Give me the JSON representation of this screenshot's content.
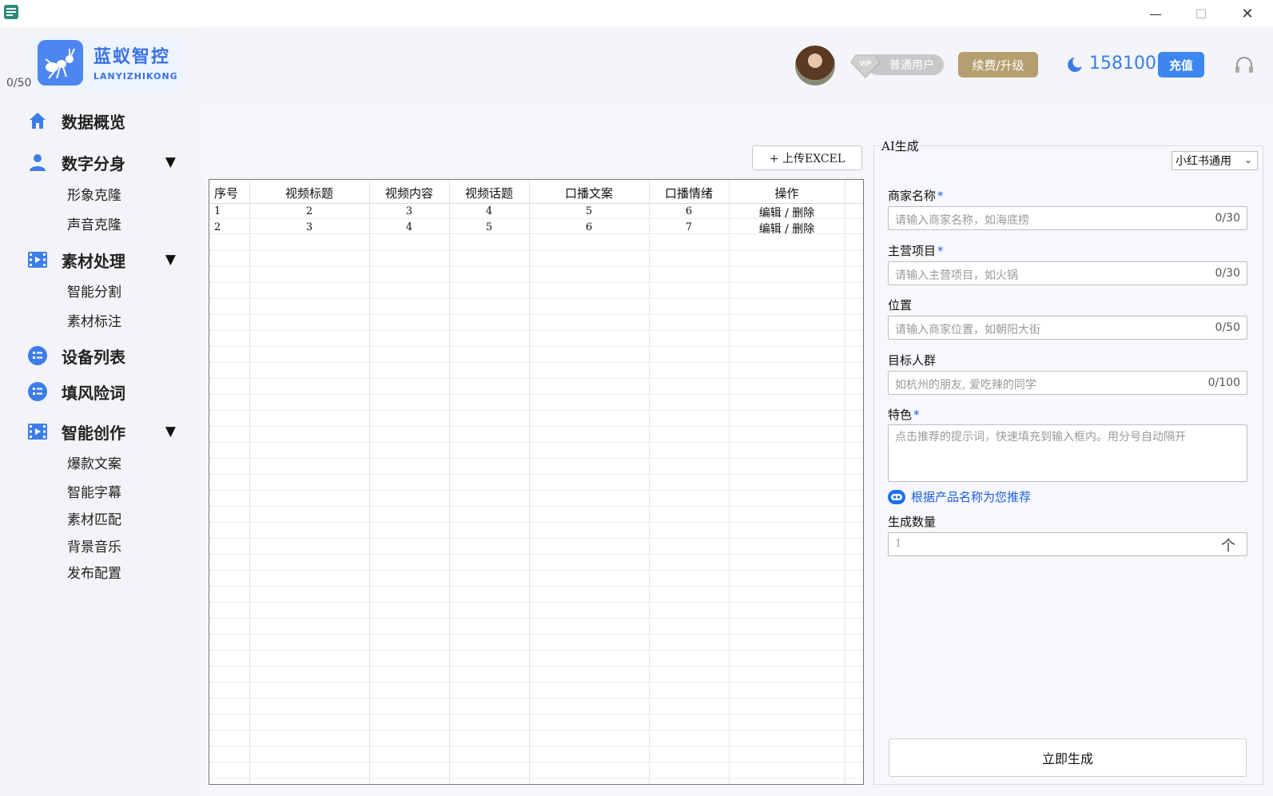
{
  "window": {
    "minimize_glyph": "—",
    "maximize_glyph": "☐",
    "close_glyph": "✕"
  },
  "sidebar": {
    "logo_cn": "蓝蚁智控",
    "logo_en": "LANYIZHIKONG",
    "counter": "0/50",
    "nav": [
      {
        "label": "数据概览",
        "icon": "home-icon"
      },
      {
        "label": "数字分身",
        "icon": "user-icon",
        "caret": "▼",
        "children": [
          "形象克隆",
          "声音克隆"
        ]
      },
      {
        "label": "素材处理",
        "icon": "film-icon",
        "caret": "▼",
        "children": [
          "智能分割",
          "素材标注"
        ]
      },
      {
        "label": "设备列表",
        "icon": "list-icon"
      },
      {
        "label": "填风险词",
        "icon": "list-icon"
      },
      {
        "label": "智能创作",
        "icon": "film-icon",
        "caret": "▼",
        "children": [
          "爆款文案",
          "智能字幕",
          "素材匹配",
          "背景音乐",
          "发布配置"
        ]
      }
    ]
  },
  "header": {
    "vip_label": "普通用户",
    "vip_mark": "VIP",
    "renew_label": "续费/升级",
    "balance": "158100",
    "recharge_label": "充值"
  },
  "toolbar": {
    "upload_label": "+ 上传EXCEL"
  },
  "table": {
    "columns": [
      "序号",
      "视频标题",
      "视频内容",
      "视频话题",
      "口播文案",
      "口播情绪",
      "操作"
    ],
    "rows": [
      [
        "1",
        "2",
        "3",
        "4",
        "5",
        "6",
        "编辑 / 删除"
      ],
      [
        "2",
        "3",
        "4",
        "5",
        "6",
        "7",
        "编辑 / 删除"
      ]
    ]
  },
  "ai_panel": {
    "title": "AI生成",
    "template": "小红书通用",
    "fields": [
      {
        "label": "商家名称",
        "required": "*",
        "placeholder": "请输入商家名称，如海底捞",
        "count": "0/30"
      },
      {
        "label": "主营项目",
        "required": "*",
        "placeholder": "请输入主营项目，如火锅",
        "count": "0/30"
      },
      {
        "label": "位置",
        "placeholder": "请输入商家位置，如朝阳大街",
        "count": "0/50"
      },
      {
        "label": "目标人群",
        "placeholder": "如杭州的朋友, 爱吃辣的同学",
        "count": "0/100"
      }
    ],
    "feature_label": "特色",
    "feature_required": "*",
    "feature_placeholder": "点击推荐的提示词，快速填充到输入框内。用分号自动隔开",
    "recommend_label": "根据产品名称为您推荐",
    "qty_label": "生成数量",
    "qty_value": "1",
    "qty_up": "个",
    "generate_label": "立即生成"
  },
  "colors": {
    "accent": "#3d86f0",
    "renew": "#b69f6f",
    "link": "#1d5de0"
  }
}
